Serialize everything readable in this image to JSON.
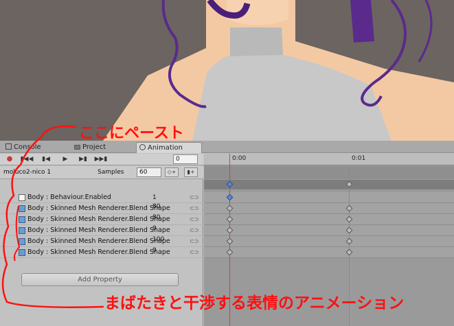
{
  "tabs": [
    {
      "label": "Console"
    },
    {
      "label": "Project"
    },
    {
      "label": "Animation"
    }
  ],
  "controls": {
    "record_icon": "record-icon",
    "frame_value": "0"
  },
  "clip": {
    "name": "moluco2-nico 1",
    "samples_label": "Samples",
    "samples_value": "60"
  },
  "ruler": {
    "labels": [
      "0:00",
      "0:01"
    ]
  },
  "properties": [
    {
      "label": "Body : Behaviour.Enabled",
      "value": "1",
      "icon": "script-icon"
    },
    {
      "label": "Body : Skinned Mesh Renderer.Blend Shape",
      "value": "80",
      "icon": "skinned-mesh-icon"
    },
    {
      "label": "Body : Skinned Mesh Renderer.Blend Shape",
      "value": "80",
      "icon": "skinned-mesh-icon"
    },
    {
      "label": "Body : Skinned Mesh Renderer.Blend Shape",
      "value": "0",
      "icon": "skinned-mesh-icon"
    },
    {
      "label": "Body : Skinned Mesh Renderer.Blend Shape",
      "value": "100",
      "icon": "skinned-mesh-icon"
    },
    {
      "label": "Body : Skinned Mesh Renderer.Blend Shape",
      "value": "0",
      "icon": "skinned-mesh-icon"
    }
  ],
  "add_property_label": "Add Property",
  "annotations": {
    "top": "ここにペースト",
    "bottom": "まばたきと干渉する表情のアニメーション"
  },
  "colors": {
    "annotation": "#ff1010",
    "playhead": "#d34040",
    "selected_key": "#5d86d6"
  }
}
